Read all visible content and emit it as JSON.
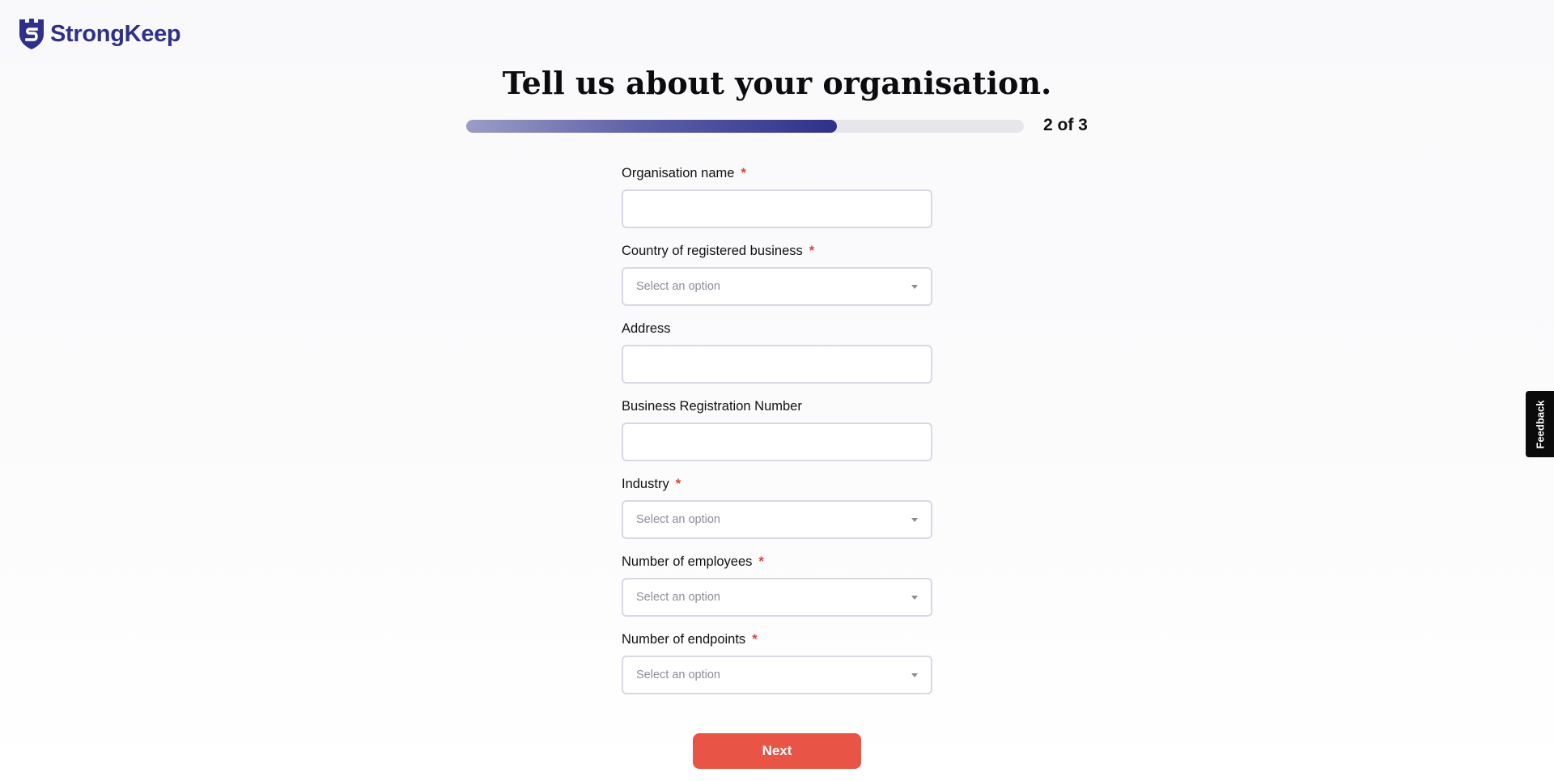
{
  "brand": {
    "name": "StrongKeep",
    "color": "#2f3188"
  },
  "page": {
    "title": "Tell us about your organisation."
  },
  "progress": {
    "label": "2 of 3",
    "fraction": 0.665,
    "current_step": 2,
    "total_steps": 3
  },
  "form": {
    "required_marker": "*",
    "fields": [
      {
        "label": "Organisation name",
        "type": "text",
        "required": true,
        "value": ""
      },
      {
        "label": "Country of registered business",
        "type": "select",
        "required": true,
        "placeholder": "Select an option"
      },
      {
        "label": "Address",
        "type": "text",
        "required": false,
        "value": ""
      },
      {
        "label": "Business Registration Number",
        "type": "text",
        "required": false,
        "value": ""
      },
      {
        "label": "Industry",
        "type": "select",
        "required": true,
        "placeholder": "Select an option"
      },
      {
        "label": "Number of employees",
        "type": "select",
        "required": true,
        "placeholder": "Select an option"
      },
      {
        "label": "Number of endpoints",
        "type": "select",
        "required": true,
        "placeholder": "Select an option"
      }
    ]
  },
  "actions": {
    "next_label": "Next",
    "next_color": "#e85445"
  },
  "feedback": {
    "label": "Feedback"
  }
}
